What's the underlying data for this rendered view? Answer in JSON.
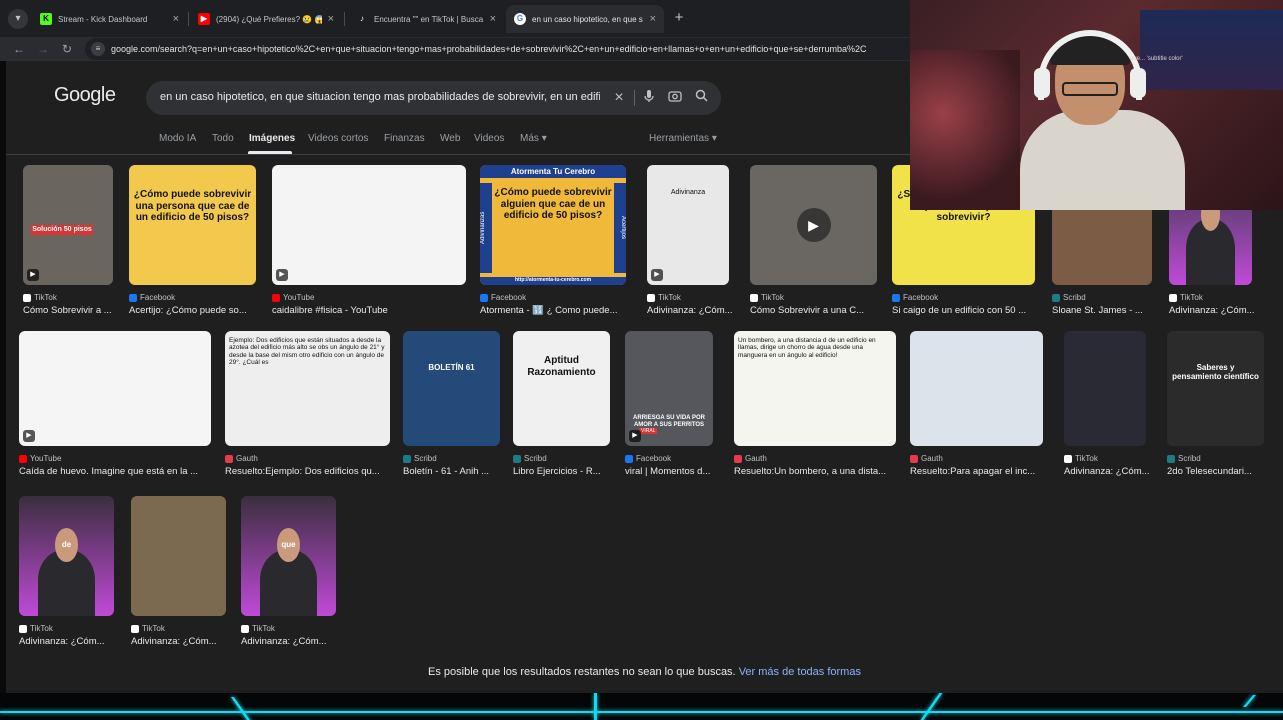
{
  "browser": {
    "tabs": [
      {
        "title": "Stream - Kick Dashboard",
        "favicon": "kick-icon",
        "color": "#53fc18",
        "active": false
      },
      {
        "title": "(2904) ¿Qué Prefieres? 😢 😱 N",
        "favicon": "youtube-icon",
        "color": "#ff0000",
        "active": false
      },
      {
        "title": "Encuentra \"\" en TikTok | Busca",
        "favicon": "tiktok-icon",
        "color": "#ffffff",
        "active": false
      },
      {
        "title": "en un caso hipotetico, en que s",
        "favicon": "google-icon",
        "color": "#ffffff",
        "active": true
      }
    ],
    "url": "google.com/search?q=en+un+caso+hipotetico%2C+en+que+situacion+tengo+mas+probabilidades+de+sobrevivir%2C+en+un+edificio+en+llamas+o+en+un+edificio+que+se+derrumba%2C"
  },
  "google": {
    "logo": "Google",
    "query": "en un caso hipotetico, en que situacion tengo mas probabilidades de sobrevivir, en un edificio en llamas o en un edificio que se derrumba",
    "filters": [
      "Modo IA",
      "Todo",
      "Imágenes",
      "Videos cortos",
      "Finanzas",
      "Web",
      "Videos",
      "Más"
    ],
    "active_filter": "Imágenes",
    "tools": "Herramientas"
  },
  "results": [
    {
      "source": "TikTok",
      "caption": "Cómo Sobrevivir a ...",
      "thumb_text": "Solución 50 pisos",
      "bg": "#6b6560",
      "video": true
    },
    {
      "source": "Facebook",
      "caption": "Acertijo: ¿Cómo puede so...",
      "thumb_text": "¿Cómo puede sobrevivir una persona que cae de un edificio de 50 pisos?",
      "bg": "#f2c94c",
      "video": false
    },
    {
      "source": "YouTube",
      "caption": "caidalibre #fisica - YouTube",
      "thumb_text": "",
      "bg": "#f4f4f4",
      "video": true
    },
    {
      "source": "Facebook",
      "caption": "Atormenta - 🔢 ¿ Como puede...",
      "thumb_text": "¿Cómo puede sobrevivir alguien que cae de un edificio de 50 pisos?",
      "header": "Atormenta Tu Cerebro",
      "footer": "http://atormenta-tu-cerebro.com",
      "side_left": "Adivinanzas",
      "side_right": "Acertijos",
      "bg": "#f0b93a",
      "video": false
    },
    {
      "source": "TikTok",
      "caption": "Adivinanza: ¿Cóm...",
      "thumb_text": "Adivinanza",
      "bg": "#e8e8e8",
      "video": true
    },
    {
      "source": "TikTok",
      "caption": "Cómo Sobrevivir a una C...",
      "thumb_text": "",
      "bg": "#6a6662",
      "video": true
    },
    {
      "source": "Facebook",
      "caption": "Si caigo de un edificio con 50 ...",
      "thumb_text": "¿Si caigo de un edificio con 50 pisos, como podría sobrevivir?",
      "bg": "#f2e24a",
      "video": false
    },
    {
      "source": "Scribd",
      "caption": "Sloane St. James - ...",
      "thumb_text": "",
      "bg": "#7d5c45",
      "video": false
    },
    {
      "source": "TikTok",
      "caption": "Adivinanza: ¿Cóm...",
      "thumb_text": "",
      "bg": "#3a3a48",
      "video": false
    },
    {
      "source": "YouTube",
      "caption": "Caída de huevo. Imagine que está en la ...",
      "thumb_text": "",
      "bg": "#f5f5f5",
      "video": true
    },
    {
      "source": "Gauth",
      "caption": "Resuelto:Ejemplo: Dos edificios qu...",
      "thumb_text": "Ejemplo: Dos edificios que están situados a desde la azotea del edificio más alto se obs un ángulo de 21° y desde la base del mism otro edificio con un ángulo de 29°. ¿Cuál es",
      "bg": "#eeeeee",
      "video": false
    },
    {
      "source": "Scribd",
      "caption": "Boletín - 61 - Anih ...",
      "thumb_text": "BOLETÍN 61",
      "bg": "#234a78",
      "video": false
    },
    {
      "source": "Scribd",
      "caption": "Libro Ejercicios - R...",
      "thumb_text": "Aptitud Razonamiento",
      "bg": "#f0f0f0",
      "video": false
    },
    {
      "source": "Facebook",
      "caption": "viral | Momentos d...",
      "thumb_text": "ARRIESGA SU VIDA POR AMOR A SUS PERRITOS",
      "badge": "VIRAL",
      "bg": "#55575c",
      "video": true
    },
    {
      "source": "Gauth",
      "caption": "Resuelto:Un bombero, a una dista...",
      "thumb_text": "Un bombero, a una distancia d de un edificio en llamas, dirige un chorro de agua desde una manguera en un ángulo al edificio!",
      "bg": "#f5f5f0",
      "video": false
    },
    {
      "source": "Gauth",
      "caption": "Resuelto:Para apagar el inc...",
      "thumb_text": "",
      "bg": "#dce3ea",
      "video": false
    },
    {
      "source": "TikTok",
      "caption": "Adivinanza: ¿Cóm...",
      "thumb_text": "",
      "bg": "#2a2a34",
      "video": false
    },
    {
      "source": "Scribd",
      "caption": "2do Telesecundari...",
      "thumb_text": "Saberes y pensamiento científico",
      "bg": "#2b2b2b",
      "video": false
    },
    {
      "source": "TikTok",
      "caption": "Adivinanza: ¿Cóm...",
      "thumb_text": "de",
      "bg": "#3a2f3e",
      "video": false
    },
    {
      "source": "TikTok",
      "caption": "Adivinanza: ¿Cóm...",
      "thumb_text": "",
      "bg": "#7b6a50",
      "video": false
    },
    {
      "source": "TikTok",
      "caption": "Adivinanza: ¿Cóm...",
      "thumb_text": "que",
      "bg": "#3a2f3e",
      "video": false
    }
  ],
  "source_colors": {
    "TikTok": "#ffffff",
    "Facebook": "#1877f2",
    "YouTube": "#ff0000",
    "Scribd": "#1e7b85",
    "Gauth": "#e8394d"
  },
  "bottom": {
    "message": "Es posible que los resultados restantes no sean lo que buscas.",
    "link": "Ver más de todas formas"
  },
  "webcam": {
    "overlay_text": "que... 'subtitle color'"
  }
}
